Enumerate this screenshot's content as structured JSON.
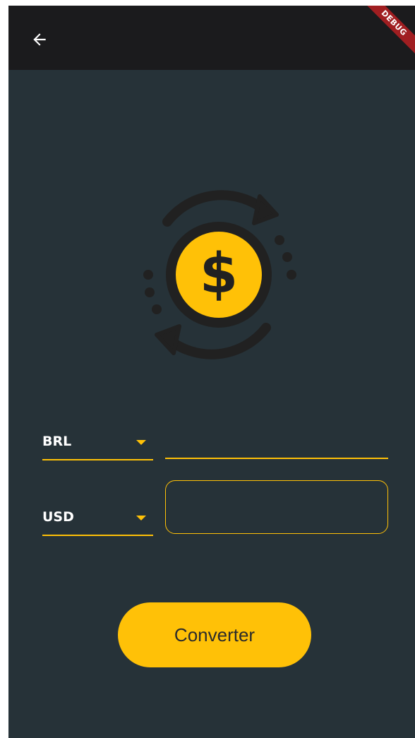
{
  "appbar": {
    "back_icon": "arrow-left-icon",
    "debug_label": "DEBUG"
  },
  "logo": {
    "icon": "currency-exchange-dollar-icon",
    "symbol": "$"
  },
  "converter": {
    "from_currency": "BRL",
    "to_currency": "USD",
    "from_value": "",
    "to_value": "",
    "button_label": "Converter"
  },
  "colors": {
    "background": "#263238",
    "appbar": "#1b1b1d",
    "accent": "#ffc107",
    "icon_dark": "#212121",
    "debug_ribbon": "#a01e21"
  }
}
